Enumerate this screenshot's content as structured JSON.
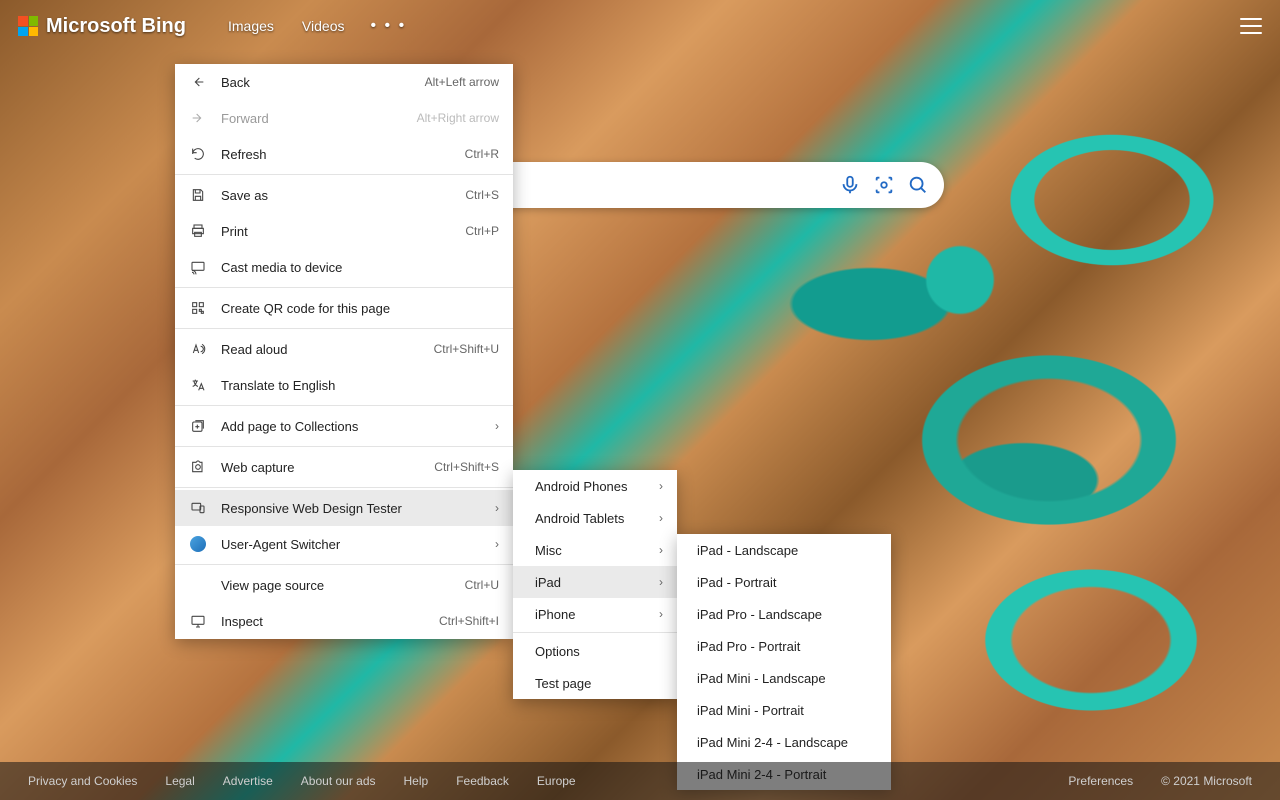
{
  "header": {
    "brand": "Microsoft Bing",
    "nav": {
      "images": "Images",
      "videos": "Videos"
    }
  },
  "search": {
    "placeholder": ""
  },
  "context_menu": {
    "back": {
      "label": "Back",
      "accel": "Alt+Left arrow"
    },
    "forward": {
      "label": "Forward",
      "accel": "Alt+Right arrow"
    },
    "refresh": {
      "label": "Refresh",
      "accel": "Ctrl+R"
    },
    "save_as": {
      "label": "Save as",
      "accel": "Ctrl+S"
    },
    "print": {
      "label": "Print",
      "accel": "Ctrl+P"
    },
    "cast": {
      "label": "Cast media to device"
    },
    "qr": {
      "label": "Create QR code for this page"
    },
    "read": {
      "label": "Read aloud",
      "accel": "Ctrl+Shift+U"
    },
    "translate": {
      "label": "Translate to English"
    },
    "collections": {
      "label": "Add page to Collections"
    },
    "capture": {
      "label": "Web capture",
      "accel": "Ctrl+Shift+S"
    },
    "rwd": {
      "label": "Responsive Web Design Tester"
    },
    "ua": {
      "label": "User-Agent Switcher"
    },
    "source": {
      "label": "View page source",
      "accel": "Ctrl+U"
    },
    "inspect": {
      "label": "Inspect",
      "accel": "Ctrl+Shift+I"
    }
  },
  "rwd_submenu": {
    "android_phones": "Android Phones",
    "android_tablets": "Android Tablets",
    "misc": "Misc",
    "ipad": "iPad",
    "iphone": "iPhone",
    "options": "Options",
    "test_page": "Test page"
  },
  "ipad_submenu": {
    "ipad_landscape": "iPad - Landscape",
    "ipad_portrait": "iPad - Portrait",
    "ipad_pro_landscape": "iPad Pro - Landscape",
    "ipad_pro_portrait": "iPad Pro - Portrait",
    "ipad_mini_landscape": "iPad Mini - Landscape",
    "ipad_mini_portrait": "iPad Mini - Portrait",
    "ipad_mini24_landscape": "iPad Mini 2-4 - Landscape",
    "ipad_mini24_portrait": "iPad Mini 2-4 - Portrait"
  },
  "footer": {
    "privacy": "Privacy and Cookies",
    "legal": "Legal",
    "advertise": "Advertise",
    "about_ads": "About our ads",
    "help": "Help",
    "feedback": "Feedback",
    "europe": "Europe",
    "preferences": "Preferences",
    "copyright": "© 2021 Microsoft"
  }
}
